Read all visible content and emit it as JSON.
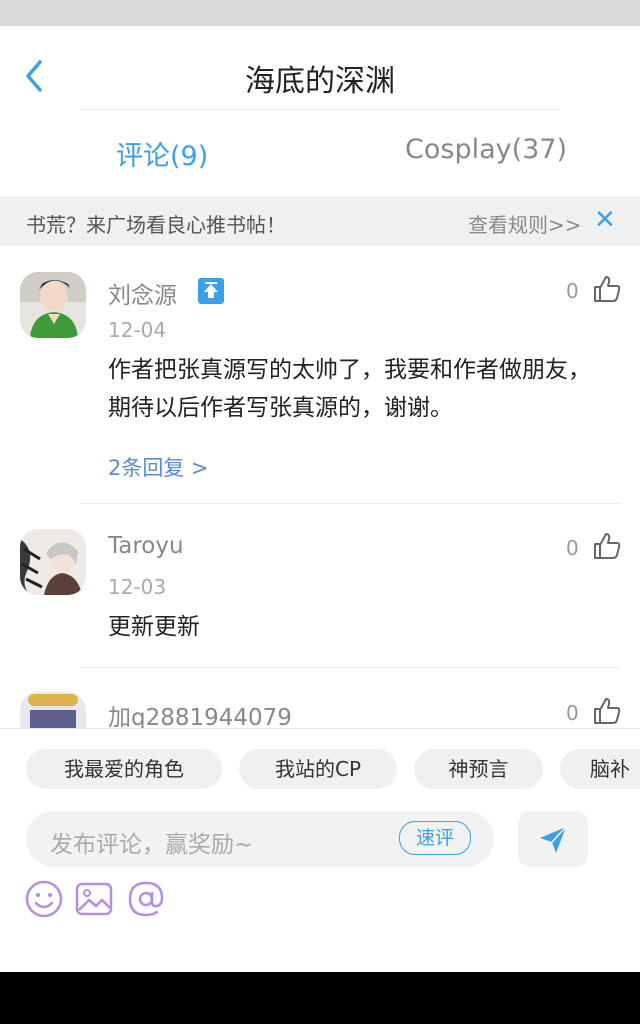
{
  "header": {
    "title": "海底的深渊"
  },
  "tabs": [
    {
      "label": "评论(9)",
      "active": true
    },
    {
      "label": "Cosplay(37)",
      "active": false
    }
  ],
  "banner": {
    "text": "书荒？来广场看良心推书帖！",
    "link": "查看规则>>",
    "close": "✕"
  },
  "comments": [
    {
      "user": "刘念源",
      "date": "12-04",
      "text": "作者把张真源写的太帅了，我要和作者做朋友，期待以后作者写张真源的，谢谢。",
      "likes": "0",
      "replies": "2条回复 >"
    },
    {
      "user": "Taroyu",
      "date": "12-03",
      "text": "更新更新",
      "likes": "0"
    },
    {
      "user": "加q2881944079",
      "likes": "0"
    }
  ],
  "quick_tags": [
    "我最爱的角色",
    "我站的CP",
    "神预言",
    "脑补"
  ],
  "input": {
    "placeholder": "发布评论，赢奖励~",
    "quick_review": "速评"
  },
  "colors": {
    "accent": "#3ba0e6",
    "reply_link": "#5b8ccf"
  }
}
